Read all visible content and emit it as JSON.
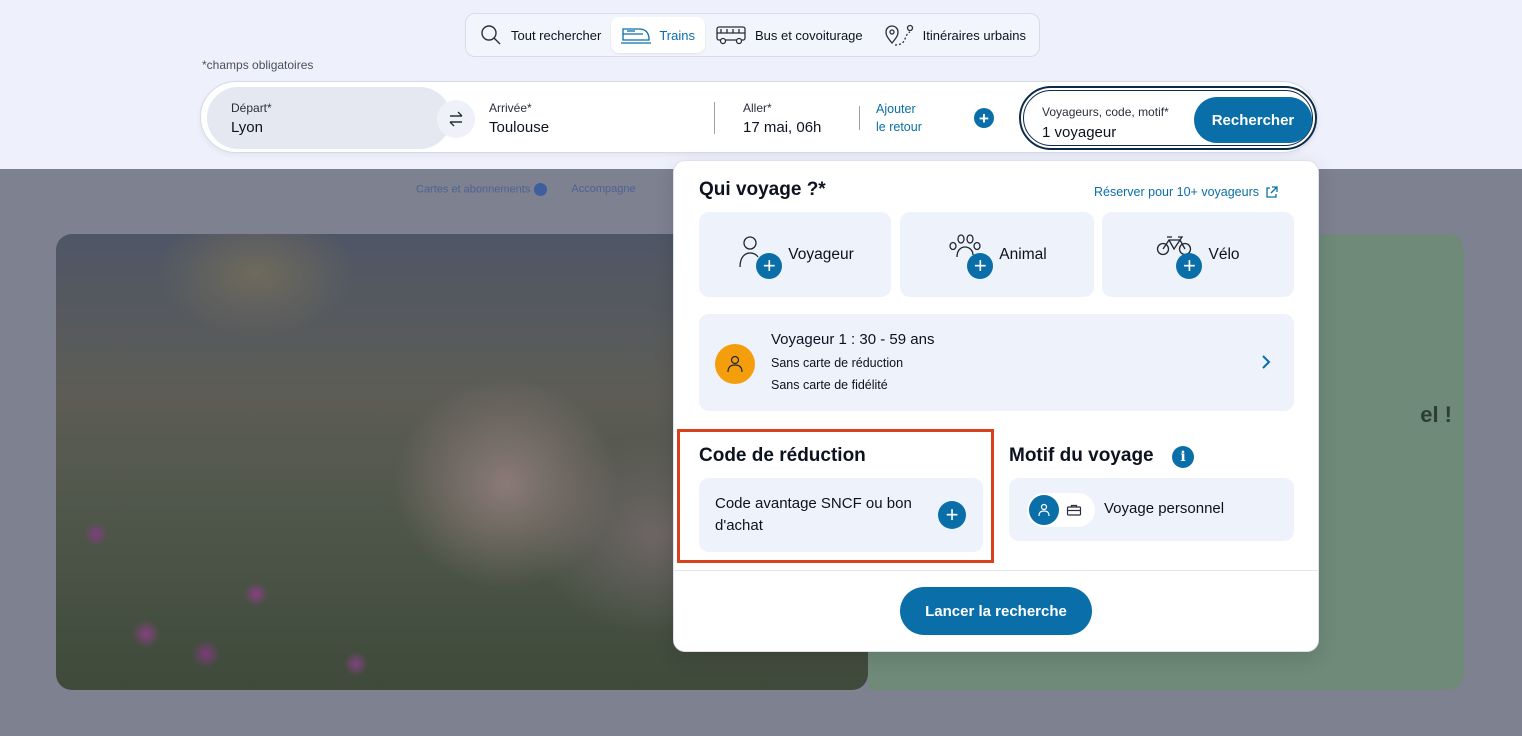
{
  "tabs": [
    {
      "label": "Tout rechercher",
      "icon": "search-icon"
    },
    {
      "label": "Trains",
      "icon": "train-icon",
      "active": true
    },
    {
      "label": "Bus et covoiturage",
      "icon": "bus-icon"
    },
    {
      "label": "Itinéraires urbains",
      "icon": "route-icon"
    }
  ],
  "required_note": "*champs obligatoires",
  "search": {
    "depart_label": "Départ*",
    "depart_value": "Lyon",
    "arrivee_label": "Arrivée*",
    "arrivee_value": "Toulouse",
    "aller_label": "Aller*",
    "aller_value": "17 mai, 06h",
    "retour_line1": "Ajouter",
    "retour_line2": "le retour",
    "voyageurs_label": "Voyageurs, code, motif*",
    "voyageurs_value": "1 voyageur",
    "search_button": "Rechercher"
  },
  "background": {
    "sublink1": "Cartes et abonnements",
    "sublink2": "Accompagne",
    "hero_text_fragment": "el !"
  },
  "panel": {
    "title": "Qui voyage ?*",
    "group_link": "Réserver pour 10+ voyageurs",
    "add_options": [
      {
        "label": "Voyageur",
        "icon": "person-add-icon"
      },
      {
        "label": "Animal",
        "icon": "paw-add-icon"
      },
      {
        "label": "Vélo",
        "icon": "bike-add-icon"
      }
    ],
    "traveler": {
      "title": "Voyageur 1 : 30 - 59 ans",
      "line1": "Sans carte de réduction",
      "line2": "Sans carte de fidélité"
    },
    "code_section_title": "Code de réduction",
    "code_card_text": "Code avantage SNCF ou bon d'achat",
    "motif_section_title": "Motif du voyage",
    "motif_value": "Voyage personnel",
    "launch_button": "Lancer la recherche"
  },
  "colors": {
    "primary": "#0a6fa8",
    "highlight": "#d9401c",
    "avatar": "#f59e0b"
  }
}
